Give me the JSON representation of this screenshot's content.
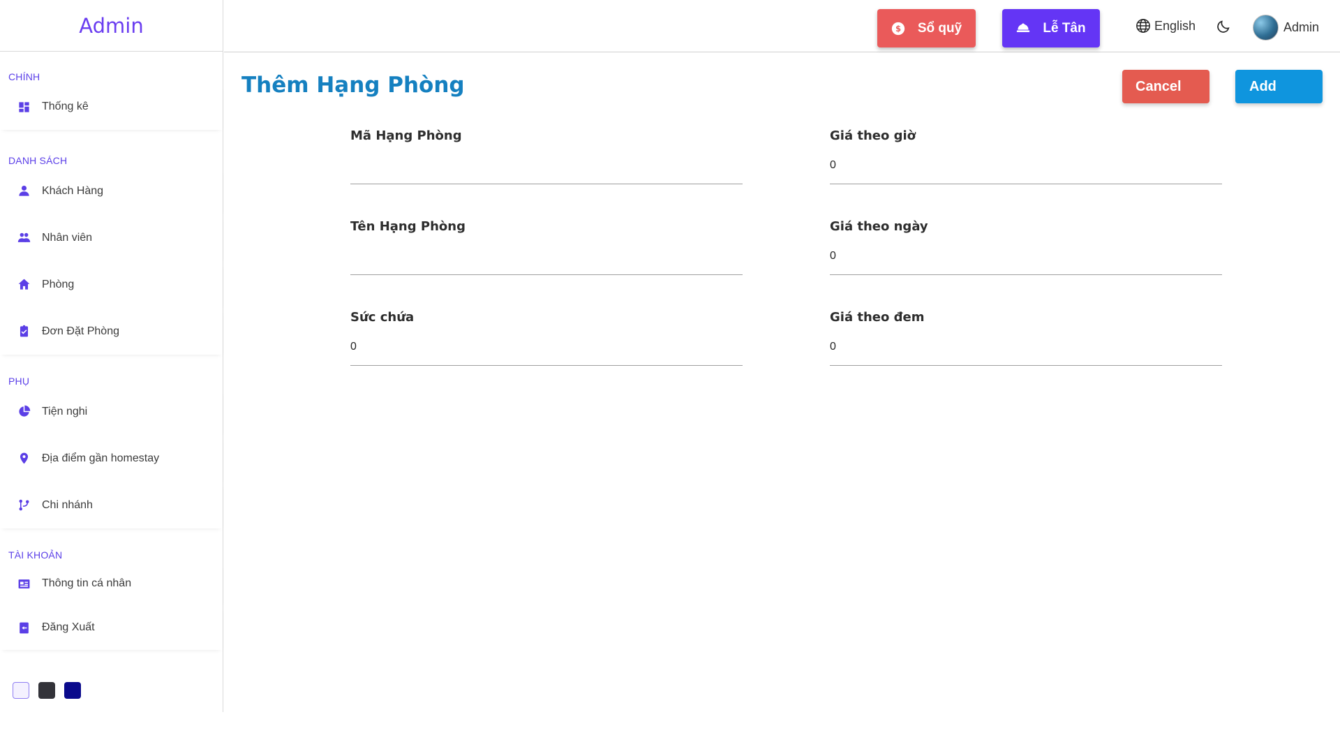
{
  "sidebar": {
    "brand": "Admin",
    "sections": [
      {
        "title": "CHÍNH",
        "items": [
          {
            "label": "Thống kê",
            "icon": "dashboard-icon"
          }
        ]
      },
      {
        "title": "DANH SÁCH",
        "items": [
          {
            "label": "Khách Hàng",
            "icon": "person-icon"
          },
          {
            "label": "Nhân viên",
            "icon": "people-icon"
          },
          {
            "label": "Phòng",
            "icon": "home-icon"
          },
          {
            "label": "Đơn Đặt Phòng",
            "icon": "clipboard-check-icon"
          }
        ]
      },
      {
        "title": "PHỤ",
        "items": [
          {
            "label": "Tiện nghi",
            "icon": "pie-chart-icon"
          },
          {
            "label": "Địa điểm gần homestay",
            "icon": "location-pin-icon"
          },
          {
            "label": "Chi nhánh",
            "icon": "branch-icon"
          }
        ]
      },
      {
        "title": "TÀI KHOẢN",
        "items": [
          {
            "label": "Thông tin cá nhân",
            "icon": "id-card-icon"
          },
          {
            "label": "Đăng Xuất",
            "icon": "logout-icon"
          }
        ]
      }
    ],
    "theme_colors": [
      "#f4f1ff",
      "#333339",
      "#0a0a8c"
    ]
  },
  "topbar": {
    "so_quy": "Sổ quỹ",
    "le_tan": "Lễ Tân",
    "language": "English",
    "user": "Admin"
  },
  "main": {
    "title": "Thêm Hạng Phòng",
    "cancel": "Cancel",
    "add": "Add",
    "fields": {
      "ma_hang_phong": {
        "label": "Mã Hạng Phòng",
        "value": ""
      },
      "ten_hang_phong": {
        "label": "Tên Hạng Phòng",
        "value": ""
      },
      "suc_chua": {
        "label": "Sức chứa",
        "value": "0"
      },
      "gia_theo_gio": {
        "label": "Giá theo giờ",
        "value": "0"
      },
      "gia_theo_ngay": {
        "label": "Giá theo ngày",
        "value": "0"
      },
      "gia_theo_dem": {
        "label": "Giá theo đem",
        "value": "0"
      }
    }
  },
  "colors": {
    "accent": "#6435f5",
    "danger": "#ea5a5a",
    "primary": "#0f95de",
    "title": "#1580c0"
  }
}
